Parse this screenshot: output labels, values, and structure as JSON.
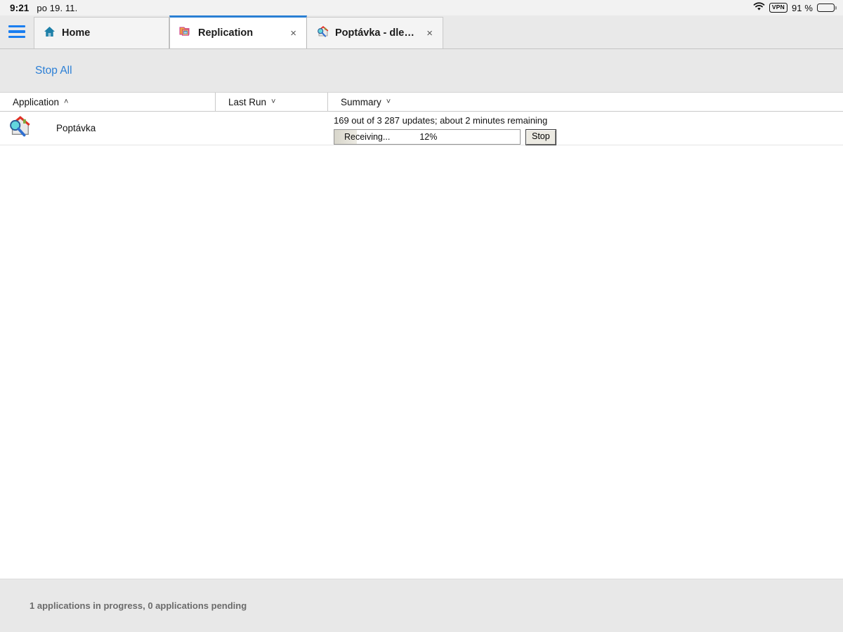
{
  "statusbar": {
    "time": "9:21",
    "date": "po 19. 11.",
    "wifi_icon": "wifi-icon",
    "vpn_label": "VPN",
    "battery_percent": "91 %",
    "battery_icon": "battery-icon",
    "battery_level": 88
  },
  "menu": {
    "hamburger_icon": "hamburger-menu-icon"
  },
  "tabs": [
    {
      "label": "Home",
      "icon": "home-house-icon",
      "active": false,
      "closable": false
    },
    {
      "label": "Replication",
      "icon": "folder-replication-icon",
      "active": true,
      "closable": true,
      "close_label": "×"
    },
    {
      "label": "Poptávka - dle klier...",
      "icon": "house-magnifier-icon",
      "active": false,
      "closable": true,
      "close_label": "×"
    }
  ],
  "toolbar": {
    "stop_all_label": "Stop All"
  },
  "table": {
    "columns": [
      {
        "label": "Application",
        "sort": "asc",
        "caret": "˄"
      },
      {
        "label": "Last Run",
        "sort": "none",
        "caret": "˅"
      },
      {
        "label": "Summary",
        "sort": "none",
        "caret": "˅"
      }
    ],
    "rows": [
      {
        "app_icon": "house-magnifier-icon",
        "app_name": "Poptávka",
        "last_run": "",
        "summary_text": "169 out of 3 287 updates; about 2 minutes remaining",
        "progress_label": "Receiving...",
        "progress_percent": "12%",
        "progress_value": 12,
        "stop_button_label": "Stop"
      }
    ]
  },
  "footer": {
    "status_text": "1 applications in progress, 0 applications pending"
  },
  "colors": {
    "accent_blue": "#2b7fd6",
    "hamburger_blue": "#1a7ef0",
    "toolbar_gray": "#e8e8e8",
    "tabbar_gray": "#e9e9e9",
    "footer_gray": "#e8e8e8",
    "active_tab_border": "#2a7fd4",
    "footer_text": "#6b6b6b"
  }
}
